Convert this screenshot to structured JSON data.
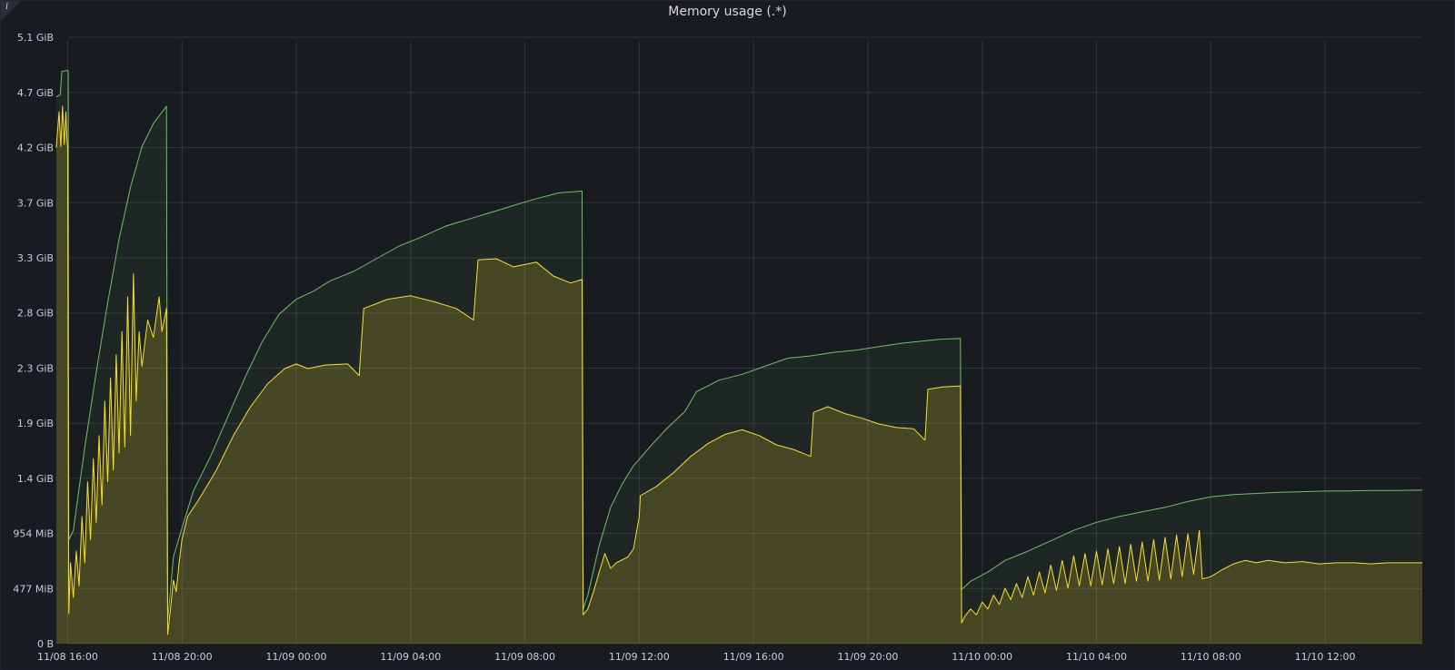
{
  "panel": {
    "title": "Memory usage (.*)",
    "info_icon": "info-icon"
  },
  "colors": {
    "background": "#181b1f",
    "grid": "rgba(204,204,220,0.14)",
    "series_green": "#73bf69",
    "series_yellow": "#fade2a"
  },
  "chart_data": {
    "type": "area",
    "title": "Memory usage (.*)",
    "xlabel": "",
    "ylabel": "",
    "x_unit": "hours since 11/08 16:00",
    "y_unit": "MiB",
    "xlim": [
      -0.15,
      23.7
    ],
    "ylim": [
      0,
      5215
    ],
    "grid": true,
    "legend": "none",
    "x_ticks": [
      {
        "x": 0,
        "label": "11/08 16:00"
      },
      {
        "x": 2,
        "label": "11/08 20:00"
      },
      {
        "x": 4,
        "label": "11/09 00:00"
      },
      {
        "x": 6,
        "label": "11/09 04:00"
      },
      {
        "x": 8,
        "label": "11/09 08:00"
      },
      {
        "x": 10,
        "label": "11/09 12:00"
      },
      {
        "x": 12,
        "label": "11/09 16:00"
      },
      {
        "x": 14,
        "label": "11/09 20:00"
      },
      {
        "x": 16,
        "label": "11/10 00:00"
      },
      {
        "x": 18,
        "label": "11/10 04:00"
      },
      {
        "x": 20,
        "label": "11/10 08:00"
      },
      {
        "x": 22,
        "label": "11/10 12:00"
      }
    ],
    "y_ticks": [
      {
        "y": 0,
        "label": "0 B"
      },
      {
        "y": 477,
        "label": "477 MiB"
      },
      {
        "y": 954,
        "label": "954 MiB"
      },
      {
        "y": 1431,
        "label": "1.4 GiB"
      },
      {
        "y": 1907,
        "label": "1.9 GiB"
      },
      {
        "y": 2384,
        "label": "2.3 GiB"
      },
      {
        "y": 2861,
        "label": "2.8 GiB"
      },
      {
        "y": 3338,
        "label": "3.3 GiB"
      },
      {
        "y": 3815,
        "label": "3.7 GiB"
      },
      {
        "y": 4292,
        "label": "4.2 GiB"
      },
      {
        "y": 4768,
        "label": "4.7 GiB"
      },
      {
        "y": 5245,
        "label": "5.1 GiB"
      }
    ],
    "series": [
      {
        "color": "#73bf69",
        "points": [
          [
            -0.2,
            4730
          ],
          [
            -0.13,
            4750
          ],
          [
            -0.1,
            4950
          ],
          [
            0.0,
            4960
          ],
          [
            0.01,
            4950
          ],
          [
            0.02,
            900
          ],
          [
            0.1,
            980
          ],
          [
            0.3,
            1700
          ],
          [
            0.5,
            2350
          ],
          [
            0.7,
            2950
          ],
          [
            0.9,
            3500
          ],
          [
            1.1,
            3950
          ],
          [
            1.3,
            4300
          ],
          [
            1.5,
            4500
          ],
          [
            1.73,
            4650
          ],
          [
            1.75,
            200
          ],
          [
            1.85,
            750
          ],
          [
            2.0,
            1000
          ],
          [
            2.2,
            1320
          ],
          [
            2.5,
            1620
          ],
          [
            2.8,
            1960
          ],
          [
            3.1,
            2300
          ],
          [
            3.4,
            2610
          ],
          [
            3.7,
            2850
          ],
          [
            4.0,
            2980
          ],
          [
            4.3,
            3050
          ],
          [
            4.6,
            3140
          ],
          [
            5.0,
            3220
          ],
          [
            5.4,
            3330
          ],
          [
            5.8,
            3440
          ],
          [
            6.2,
            3520
          ],
          [
            6.6,
            3610
          ],
          [
            7.0,
            3670
          ],
          [
            7.4,
            3730
          ],
          [
            7.8,
            3790
          ],
          [
            8.2,
            3850
          ],
          [
            8.6,
            3900
          ],
          [
            9.0,
            3915
          ],
          [
            9.02,
            300
          ],
          [
            9.1,
            420
          ],
          [
            9.3,
            850
          ],
          [
            9.5,
            1180
          ],
          [
            9.7,
            1380
          ],
          [
            9.9,
            1540
          ],
          [
            10.2,
            1710
          ],
          [
            10.5,
            1870
          ],
          [
            10.8,
            2010
          ],
          [
            11.0,
            2180
          ],
          [
            11.4,
            2280
          ],
          [
            11.8,
            2330
          ],
          [
            12.2,
            2400
          ],
          [
            12.6,
            2470
          ],
          [
            13.0,
            2490
          ],
          [
            13.4,
            2520
          ],
          [
            13.8,
            2540
          ],
          [
            14.2,
            2570
          ],
          [
            14.6,
            2600
          ],
          [
            15.0,
            2620
          ],
          [
            15.3,
            2635
          ],
          [
            15.62,
            2640
          ],
          [
            15.64,
            470
          ],
          [
            15.8,
            540
          ],
          [
            16.1,
            620
          ],
          [
            16.4,
            720
          ],
          [
            16.8,
            800
          ],
          [
            17.2,
            890
          ],
          [
            17.6,
            980
          ],
          [
            18.0,
            1050
          ],
          [
            18.4,
            1100
          ],
          [
            18.8,
            1140
          ],
          [
            19.2,
            1180
          ],
          [
            19.6,
            1230
          ],
          [
            20.0,
            1270
          ],
          [
            20.4,
            1290
          ],
          [
            20.8,
            1300
          ],
          [
            21.2,
            1310
          ],
          [
            21.6,
            1315
          ],
          [
            22.0,
            1320
          ],
          [
            22.4,
            1322
          ],
          [
            22.8,
            1325
          ],
          [
            23.2,
            1326
          ],
          [
            23.7,
            1328
          ]
        ]
      },
      {
        "color": "#fade2a",
        "points": [
          [
            -0.2,
            4290
          ],
          [
            -0.15,
            4600
          ],
          [
            -0.12,
            4300
          ],
          [
            -0.09,
            4650
          ],
          [
            -0.06,
            4320
          ],
          [
            -0.03,
            4600
          ],
          [
            -0.01,
            4350
          ],
          [
            0.0,
            4300
          ],
          [
            0.02,
            260
          ],
          [
            0.05,
            700
          ],
          [
            0.1,
            400
          ],
          [
            0.15,
            800
          ],
          [
            0.2,
            500
          ],
          [
            0.25,
            1100
          ],
          [
            0.3,
            700
          ],
          [
            0.35,
            1400
          ],
          [
            0.4,
            900
          ],
          [
            0.45,
            1600
          ],
          [
            0.5,
            1050
          ],
          [
            0.55,
            1800
          ],
          [
            0.6,
            1200
          ],
          [
            0.65,
            2100
          ],
          [
            0.7,
            1400
          ],
          [
            0.75,
            2300
          ],
          [
            0.8,
            1500
          ],
          [
            0.85,
            2500
          ],
          [
            0.9,
            1650
          ],
          [
            0.95,
            2700
          ],
          [
            1.0,
            1700
          ],
          [
            1.05,
            3000
          ],
          [
            1.1,
            1800
          ],
          [
            1.15,
            3200
          ],
          [
            1.2,
            2100
          ],
          [
            1.25,
            2700
          ],
          [
            1.3,
            2400
          ],
          [
            1.4,
            2800
          ],
          [
            1.5,
            2650
          ],
          [
            1.6,
            3000
          ],
          [
            1.65,
            2700
          ],
          [
            1.73,
            2900
          ],
          [
            1.75,
            80
          ],
          [
            1.8,
            300
          ],
          [
            1.85,
            550
          ],
          [
            1.9,
            450
          ],
          [
            1.95,
            700
          ],
          [
            2.0,
            900
          ],
          [
            2.1,
            1100
          ],
          [
            2.3,
            1250
          ],
          [
            2.6,
            1500
          ],
          [
            2.9,
            1800
          ],
          [
            3.2,
            2050
          ],
          [
            3.5,
            2250
          ],
          [
            3.8,
            2380
          ],
          [
            4.0,
            2420
          ],
          [
            4.2,
            2380
          ],
          [
            4.5,
            2410
          ],
          [
            4.9,
            2420
          ],
          [
            5.1,
            2320
          ],
          [
            5.18,
            2900
          ],
          [
            5.6,
            2980
          ],
          [
            6.0,
            3010
          ],
          [
            6.4,
            2960
          ],
          [
            6.8,
            2900
          ],
          [
            7.1,
            2800
          ],
          [
            7.18,
            3320
          ],
          [
            7.5,
            3330
          ],
          [
            7.8,
            3260
          ],
          [
            8.2,
            3300
          ],
          [
            8.5,
            3180
          ],
          [
            8.8,
            3120
          ],
          [
            9.0,
            3150
          ],
          [
            9.02,
            250
          ],
          [
            9.1,
            300
          ],
          [
            9.2,
            450
          ],
          [
            9.3,
            620
          ],
          [
            9.4,
            780
          ],
          [
            9.5,
            650
          ],
          [
            9.6,
            700
          ],
          [
            9.8,
            750
          ],
          [
            9.9,
            820
          ],
          [
            10.0,
            1100
          ],
          [
            10.02,
            1280
          ],
          [
            10.3,
            1360
          ],
          [
            10.6,
            1480
          ],
          [
            10.9,
            1620
          ],
          [
            11.2,
            1730
          ],
          [
            11.5,
            1810
          ],
          [
            11.8,
            1850
          ],
          [
            12.1,
            1800
          ],
          [
            12.4,
            1720
          ],
          [
            12.7,
            1680
          ],
          [
            13.0,
            1620
          ],
          [
            13.05,
            2000
          ],
          [
            13.3,
            2050
          ],
          [
            13.6,
            1990
          ],
          [
            13.9,
            1950
          ],
          [
            14.2,
            1900
          ],
          [
            14.5,
            1870
          ],
          [
            14.8,
            1860
          ],
          [
            15.0,
            1760
          ],
          [
            15.05,
            2200
          ],
          [
            15.3,
            2220
          ],
          [
            15.62,
            2230
          ],
          [
            15.64,
            180
          ],
          [
            15.7,
            240
          ],
          [
            15.8,
            300
          ],
          [
            15.9,
            250
          ],
          [
            16.0,
            360
          ],
          [
            16.1,
            300
          ],
          [
            16.2,
            420
          ],
          [
            16.3,
            340
          ],
          [
            16.4,
            480
          ],
          [
            16.5,
            380
          ],
          [
            16.6,
            520
          ],
          [
            16.7,
            400
          ],
          [
            16.8,
            580
          ],
          [
            16.9,
            420
          ],
          [
            17.0,
            620
          ],
          [
            17.1,
            440
          ],
          [
            17.2,
            680
          ],
          [
            17.3,
            460
          ],
          [
            17.4,
            720
          ],
          [
            17.5,
            480
          ],
          [
            17.6,
            760
          ],
          [
            17.7,
            500
          ],
          [
            17.8,
            780
          ],
          [
            17.9,
            500
          ],
          [
            18.0,
            800
          ],
          [
            18.1,
            510
          ],
          [
            18.2,
            820
          ],
          [
            18.3,
            520
          ],
          [
            18.4,
            840
          ],
          [
            18.5,
            520
          ],
          [
            18.6,
            860
          ],
          [
            18.7,
            540
          ],
          [
            18.8,
            880
          ],
          [
            18.9,
            540
          ],
          [
            19.0,
            900
          ],
          [
            19.1,
            550
          ],
          [
            19.2,
            920
          ],
          [
            19.3,
            560
          ],
          [
            19.4,
            940
          ],
          [
            19.5,
            580
          ],
          [
            19.6,
            950
          ],
          [
            19.7,
            600
          ],
          [
            19.8,
            980
          ],
          [
            19.85,
            560
          ],
          [
            20.0,
            580
          ],
          [
            20.2,
            640
          ],
          [
            20.4,
            690
          ],
          [
            20.6,
            720
          ],
          [
            20.8,
            700
          ],
          [
            21.0,
            720
          ],
          [
            21.3,
            700
          ],
          [
            21.6,
            710
          ],
          [
            21.9,
            690
          ],
          [
            22.2,
            700
          ],
          [
            22.5,
            700
          ],
          [
            22.8,
            690
          ],
          [
            23.1,
            700
          ],
          [
            23.4,
            700
          ],
          [
            23.7,
            700
          ]
        ]
      }
    ]
  }
}
